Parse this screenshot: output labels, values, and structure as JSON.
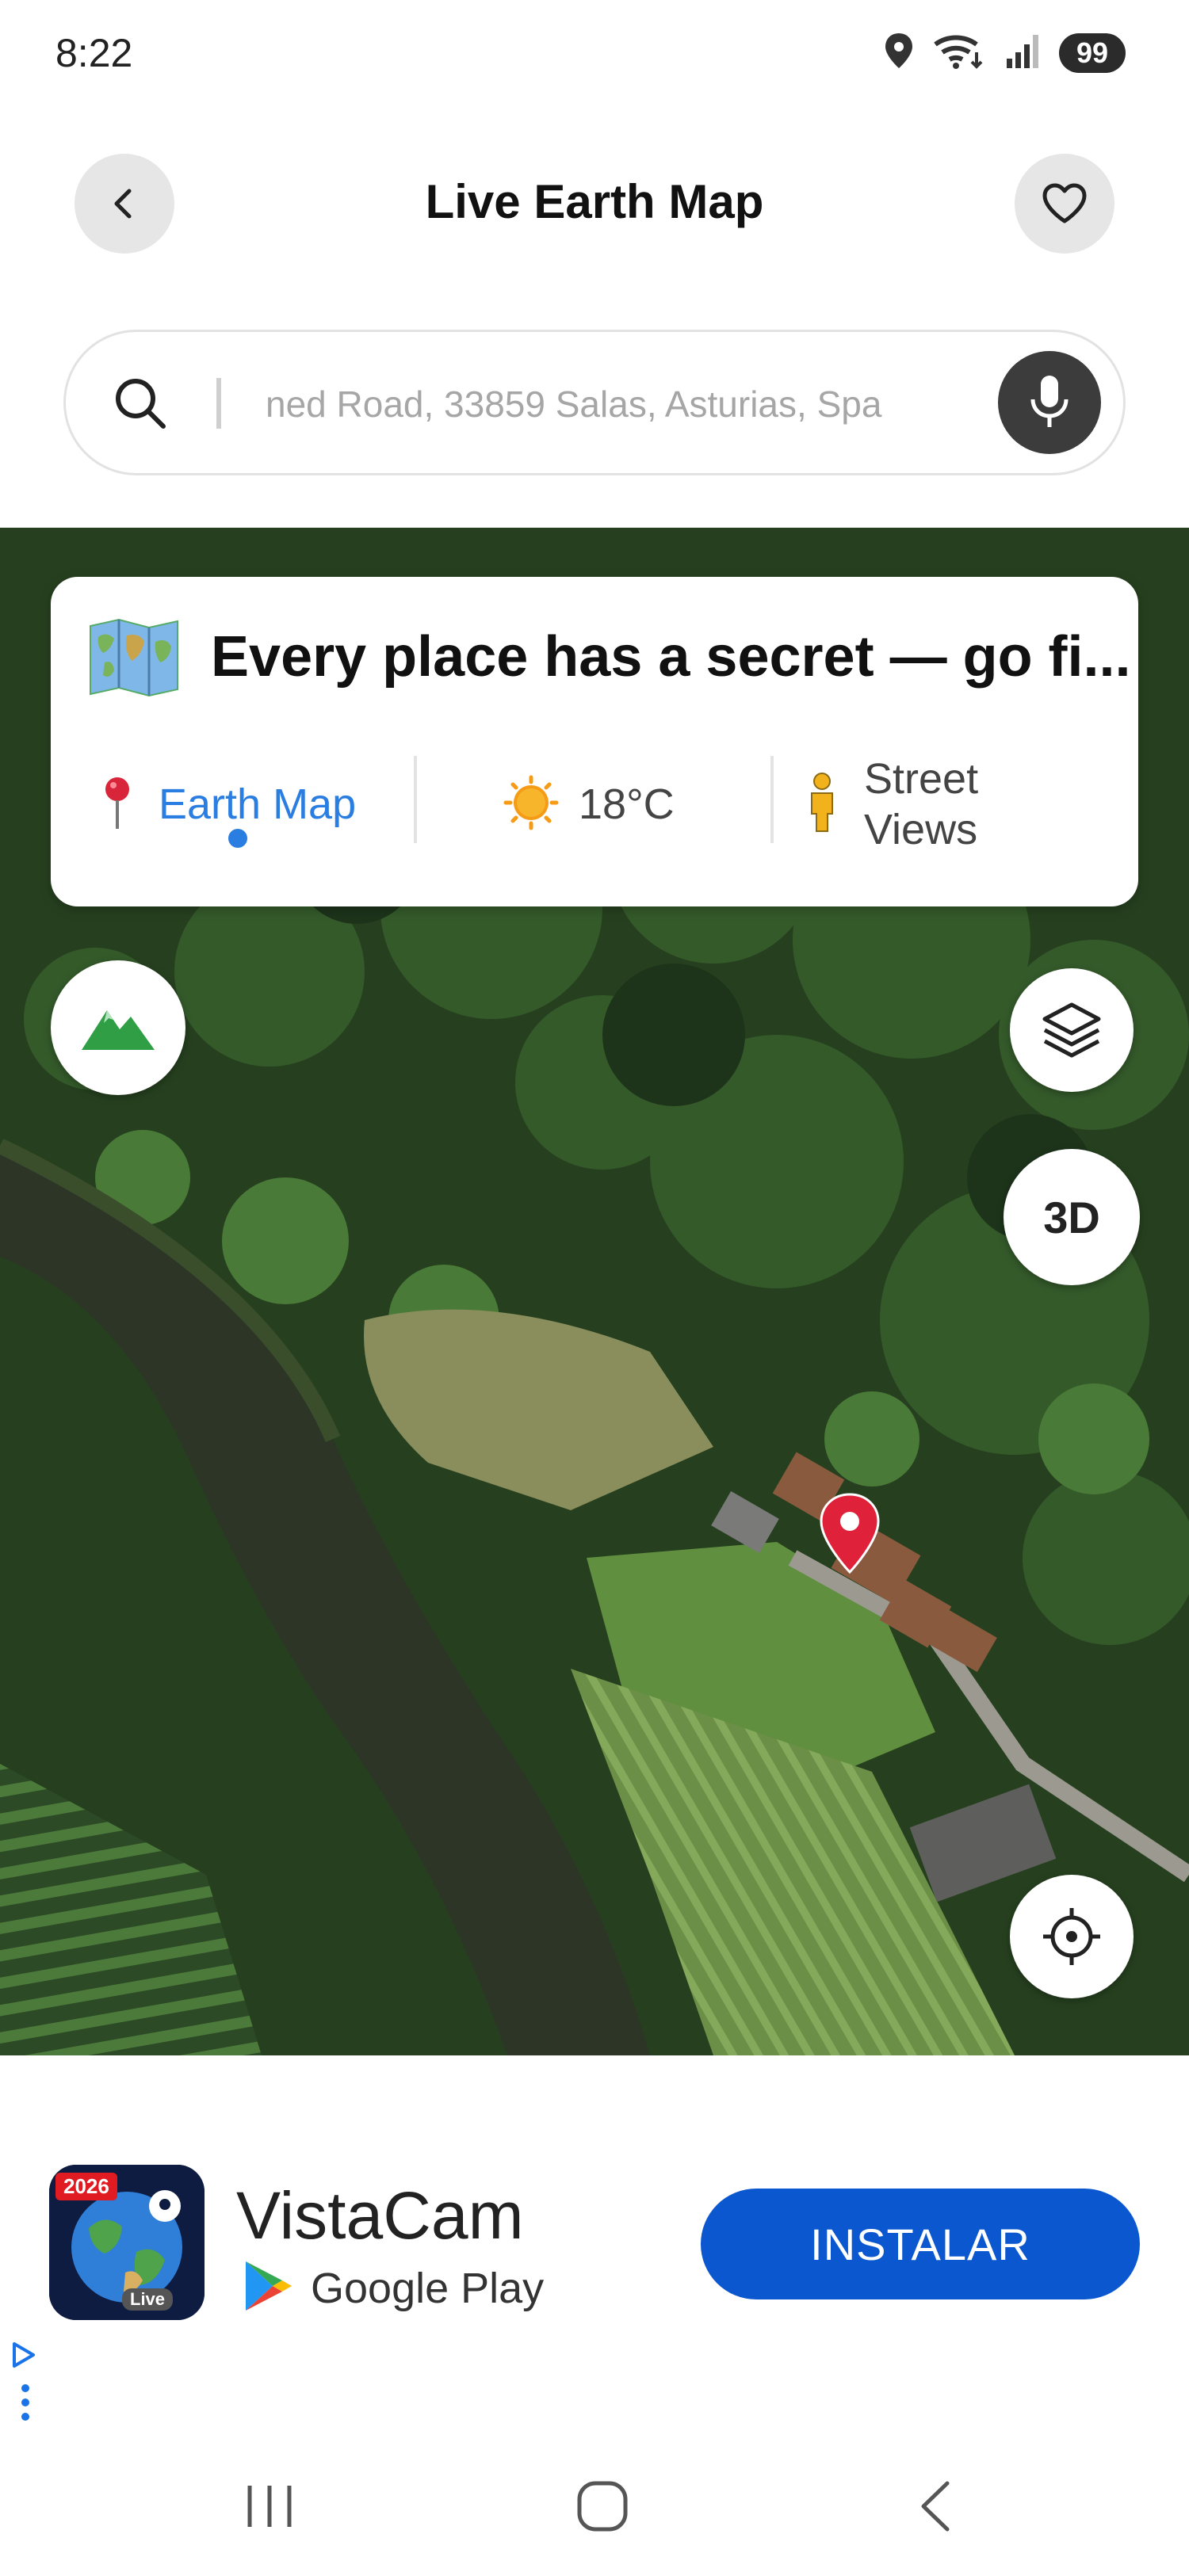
{
  "status_bar": {
    "time": "8:22",
    "battery": "99"
  },
  "header": {
    "title": "Live Earth Map"
  },
  "search": {
    "value": "ned Road, 33859 Salas, Asturias, Spa"
  },
  "card": {
    "headline": "Every place has a secret — go fi...",
    "tabs": [
      {
        "label": "Earth Map"
      },
      {
        "label": "18°C"
      },
      {
        "label": "Street Views"
      }
    ]
  },
  "map": {
    "three_d_label": "3D"
  },
  "ad": {
    "badge": "2026",
    "icon_caption": "Live",
    "name": "VistaCam",
    "store": "Google Play",
    "install_label": "INSTALAR"
  }
}
